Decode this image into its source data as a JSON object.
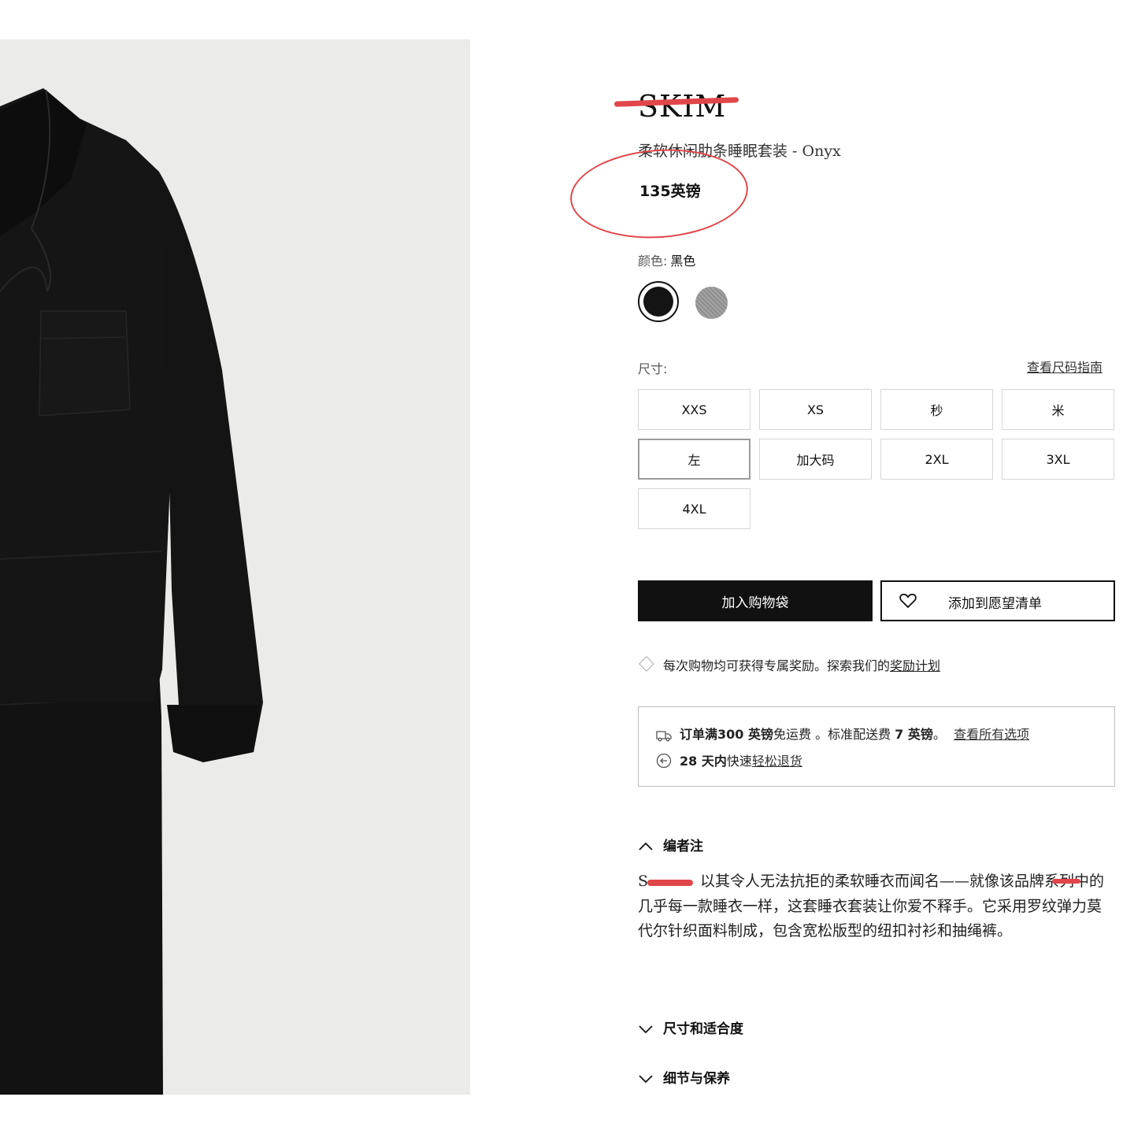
{
  "image": {
    "subject": "black-pajama-set-photo"
  },
  "product": {
    "brand": "SKIM",
    "name": "柔软休闲肋条睡眠套装 - Onyx",
    "price": "135英镑"
  },
  "color": {
    "label": "颜色:",
    "value": "黑色",
    "swatches": [
      {
        "name": "black",
        "hex": "#141414",
        "selected": true
      },
      {
        "name": "grey",
        "hex": "#999999",
        "selected": false
      }
    ]
  },
  "size": {
    "label": "尺寸:",
    "guide_link": "查看尺码指南",
    "options": [
      "XXS",
      "XS",
      "秒",
      "米",
      "左",
      "加大码",
      "2XL",
      "3XL",
      "4XL"
    ],
    "selected": "左"
  },
  "actions": {
    "add_to_bag": "加入购物袋",
    "add_to_wishlist": "添加到愿望清单"
  },
  "rewards": {
    "text": "每次购物均可获得专属奖励。探索我们的",
    "link": "奖励计划"
  },
  "shipping": {
    "free_bold": "订单满300 英镑",
    "free_rest": "免运费 。标准配送费 ",
    "fee_bold": "7 英镑",
    "fee_end": "。",
    "options_link": "查看所有选项",
    "returns_bold": "28 天内",
    "returns_rest": "快速",
    "returns_link": "轻松退货"
  },
  "editor": {
    "heading": "编者注",
    "brand_prefix": "S",
    "body": "以其令人无法抗拒的柔软睡衣而闻名——就像该品牌系列中的几乎每一款睡衣一样，这套睡衣套装让你爱不释手。它采用罗纹弹力莫代尔针织面料制成，包含宽松版型的纽扣衬衫和抽绳裤。"
  },
  "accordions": {
    "size_fit": "尺寸和适合度",
    "details_care": "细节与保养"
  },
  "colors": {
    "annotation_red": "#e0464a",
    "photo_background": "#ebebe9",
    "garment": "#121212"
  }
}
